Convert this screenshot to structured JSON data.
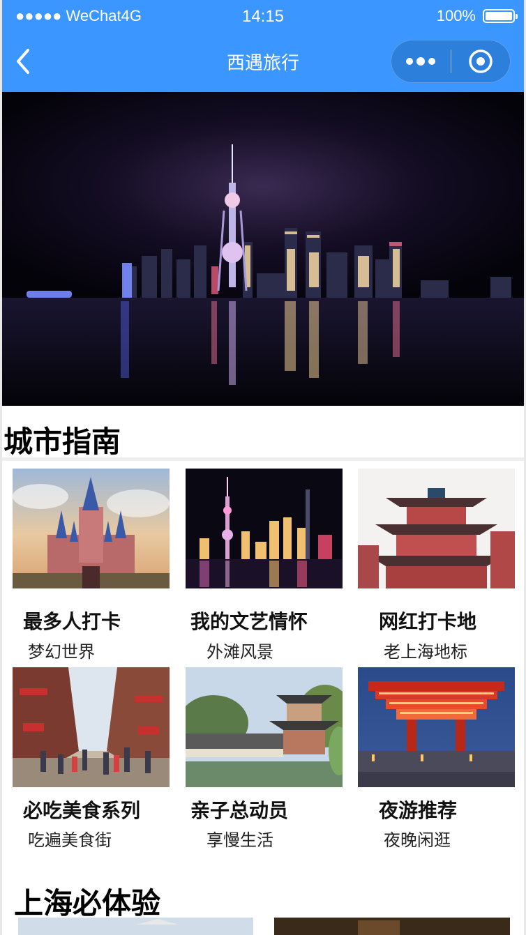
{
  "status_bar": {
    "carrier": "●●●●● WeChat4G",
    "time": "14:15",
    "battery_text": "100%"
  },
  "nav": {
    "title": "西遇旅行",
    "back_icon": "chevron-left-icon",
    "more_icon": "more-dots-icon",
    "close_icon": "target-circle-icon"
  },
  "colors": {
    "nav_bg": "#3b96ff",
    "capsule_bg": "#2d7fdc"
  },
  "hero": {
    "image": "shanghai-night-skyline"
  },
  "city_guide": {
    "title": "城市指南",
    "items": [
      {
        "title": "最多人打卡",
        "subtitle": "梦幻世界",
        "image": "disney-castle"
      },
      {
        "title": "我的文艺情怀",
        "subtitle": "外滩风景",
        "image": "bund-night-view"
      },
      {
        "title": "网红打卡地",
        "subtitle": "老上海地标",
        "image": "chinese-pavilion-building"
      },
      {
        "title": "必吃美食系列",
        "subtitle": "吃遍美食街",
        "image": "food-street"
      },
      {
        "title": "亲子总动员",
        "subtitle": "享慢生活",
        "image": "yu-garden"
      },
      {
        "title": "夜游推荐",
        "subtitle": "夜晚闲逛",
        "image": "china-pavilion-night"
      }
    ]
  },
  "must_experience": {
    "title": "上海必体验"
  }
}
